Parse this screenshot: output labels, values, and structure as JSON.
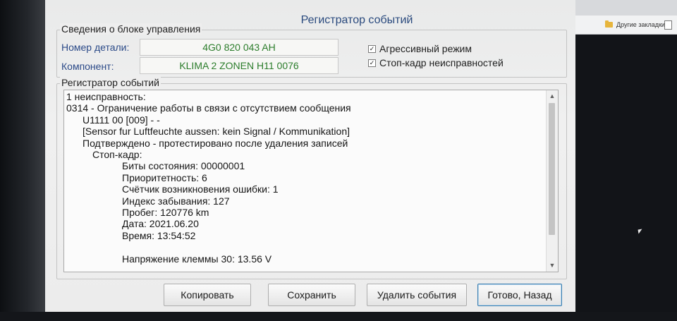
{
  "window": {
    "title": "Регистратор событий"
  },
  "control_unit": {
    "legend": "Сведения о блоке управления",
    "part_label": "Номер детали:",
    "part_value": "4G0 820 043 AH",
    "component_label": "Компонент:",
    "component_value": "KLIMA 2 ZONEN H11 0076"
  },
  "options": [
    {
      "label": "Агрессивный режим",
      "checked": true
    },
    {
      "label": "Стоп-кадр неисправностей",
      "checked": true
    }
  ],
  "event_log": {
    "legend": "Регистратор событий",
    "lines": [
      {
        "text": "1 неисправность:",
        "indent": 0
      },
      {
        "text": "0314 - Ограничение работы в связи с отсутствием сообщения",
        "indent": 0
      },
      {
        "text": "U1111 00 [009] - -",
        "indent": 1
      },
      {
        "text": "[Sensor fur Luftfeuchte aussen: kein Signal / Kommunikation]",
        "indent": 1
      },
      {
        "text": "Подтверждено - протестировано после удаления записей",
        "indent": 1
      },
      {
        "text": "Стоп-кадр:",
        "indent": 2
      },
      {
        "text": "Биты состояния: 00000001",
        "indent": 3
      },
      {
        "text": "Приоритетность: 6",
        "indent": 3
      },
      {
        "text": "Счётчик возникновения ошибки: 1",
        "indent": 3
      },
      {
        "text": "Индекс забывания: 127",
        "indent": 3
      },
      {
        "text": "Пробег: 120776 km",
        "indent": 3
      },
      {
        "text": "Дата: 2021.06.20",
        "indent": 3
      },
      {
        "text": "Время: 13:54:52",
        "indent": 3
      },
      {
        "text": "",
        "indent": 3
      },
      {
        "text": "Напряжение клеммы 30: 13.56 V",
        "indent": 3
      }
    ]
  },
  "buttons": {
    "copy": "Копировать",
    "save": "Сохранить",
    "delete_events": "Удалить события",
    "done_back": "Готово, Назад"
  },
  "browser": {
    "bookmarks_folder": "Другие закладки"
  },
  "icons": {
    "check": "✓",
    "scroll_up": "▲",
    "scroll_down": "▼"
  }
}
